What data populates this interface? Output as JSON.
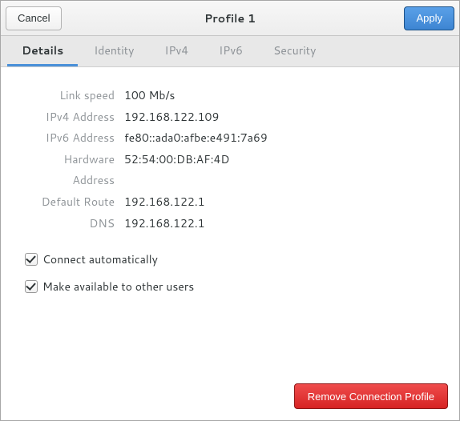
{
  "header": {
    "title": "Profile 1",
    "cancel": "Cancel",
    "apply": "Apply"
  },
  "tabs": [
    {
      "label": "Details",
      "active": true
    },
    {
      "label": "Identity",
      "active": false
    },
    {
      "label": "IPv4",
      "active": false
    },
    {
      "label": "IPv6",
      "active": false
    },
    {
      "label": "Security",
      "active": false
    }
  ],
  "details": {
    "link_speed_label": "Link speed",
    "link_speed": "100 Mb/s",
    "ipv4_label": "IPv4 Address",
    "ipv4": "192.168.122.109",
    "ipv6_label": "IPv6 Address",
    "ipv6": "fe80::ada0:afbe:e491:7a69",
    "hw_label": "Hardware Address",
    "hw": "52:54:00:DB:AF:4D",
    "route_label": "Default Route",
    "route": "192.168.122.1",
    "dns_label": "DNS",
    "dns": "192.168.122.1"
  },
  "options": {
    "connect_auto_label": "Connect automatically",
    "connect_auto_checked": true,
    "available_label": "Make available to other users",
    "available_checked": true
  },
  "footer": {
    "remove": "Remove Connection Profile"
  }
}
